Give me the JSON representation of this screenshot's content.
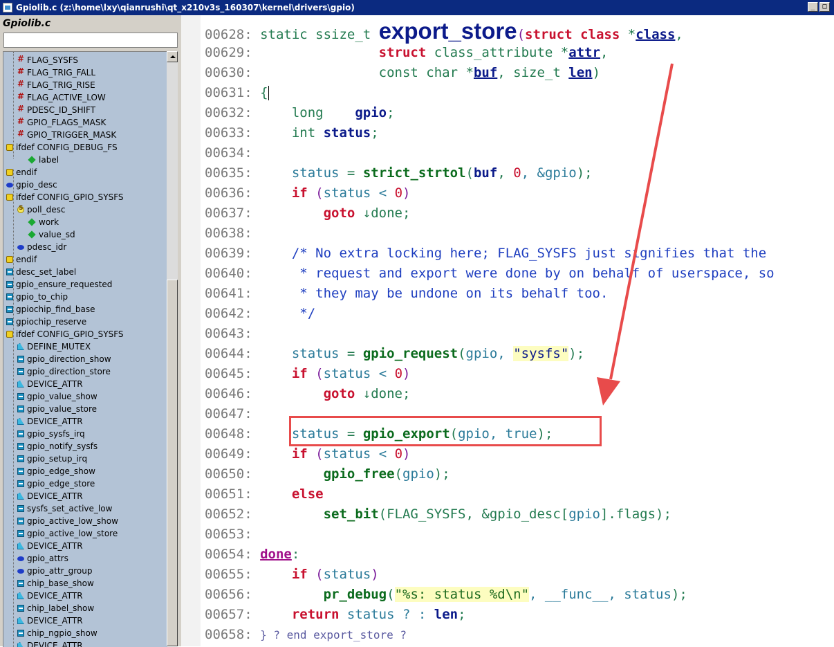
{
  "window": {
    "title": "Gpiolib.c (z:\\home\\lxy\\qianrushi\\qt_x210v3s_160307\\kernel\\drivers\\gpio)",
    "minimize": "_",
    "maximize": "□"
  },
  "sidebar": {
    "title": "Gpiolib.c",
    "search_value": "",
    "items": [
      {
        "label": "FLAG_SYSFS",
        "icon": "define-hash-icon"
      },
      {
        "label": "FLAG_TRIG_FALL",
        "icon": "define-hash-icon"
      },
      {
        "label": "FLAG_TRIG_RISE",
        "icon": "define-hash-icon"
      },
      {
        "label": "FLAG_ACTIVE_LOW",
        "icon": "define-hash-icon"
      },
      {
        "label": "PDESC_ID_SHIFT",
        "icon": "define-hash-icon"
      },
      {
        "label": "GPIO_FLAGS_MASK",
        "icon": "define-hash-icon"
      },
      {
        "label": "GPIO_TRIGGER_MASK",
        "icon": "define-hash-icon"
      },
      {
        "label": "ifdef CONFIG_DEBUG_FS",
        "icon": "ifdef-icon"
      },
      {
        "label": "label",
        "icon": "member-diamond-icon"
      },
      {
        "label": "endif",
        "icon": "ifdef-icon"
      },
      {
        "label": "gpio_desc",
        "icon": "struct-icon"
      },
      {
        "label": "ifdef CONFIG_GPIO_SYSFS",
        "icon": "ifdef-icon"
      },
      {
        "label": "poll_desc",
        "icon": "struct-s-icon"
      },
      {
        "label": "work",
        "icon": "member-diamond-icon"
      },
      {
        "label": "value_sd",
        "icon": "member-diamond-icon"
      },
      {
        "label": "pdesc_idr",
        "icon": "struct-icon"
      },
      {
        "label": "endif",
        "icon": "ifdef-icon"
      },
      {
        "label": "desc_set_label",
        "icon": "function-icon"
      },
      {
        "label": "gpio_ensure_requested",
        "icon": "function-icon"
      },
      {
        "label": "gpio_to_chip",
        "icon": "function-icon"
      },
      {
        "label": "gpiochip_find_base",
        "icon": "function-icon"
      },
      {
        "label": "gpiochip_reserve",
        "icon": "function-icon"
      },
      {
        "label": "ifdef CONFIG_GPIO_SYSFS",
        "icon": "ifdef-icon"
      },
      {
        "label": "DEFINE_MUTEX",
        "icon": "macro-icon"
      },
      {
        "label": "gpio_direction_show",
        "icon": "function-icon"
      },
      {
        "label": "gpio_direction_store",
        "icon": "function-icon"
      },
      {
        "label": "DEVICE_ATTR",
        "icon": "macro-icon"
      },
      {
        "label": "gpio_value_show",
        "icon": "function-icon"
      },
      {
        "label": "gpio_value_store",
        "icon": "function-icon"
      },
      {
        "label": "DEVICE_ATTR",
        "icon": "macro-icon"
      },
      {
        "label": "gpio_sysfs_irq",
        "icon": "function-icon"
      },
      {
        "label": "gpio_notify_sysfs",
        "icon": "function-icon"
      },
      {
        "label": "gpio_setup_irq",
        "icon": "function-icon"
      },
      {
        "label": "gpio_edge_show",
        "icon": "function-icon"
      },
      {
        "label": "gpio_edge_store",
        "icon": "function-icon"
      },
      {
        "label": "DEVICE_ATTR",
        "icon": "macro-icon"
      },
      {
        "label": "sysfs_set_active_low",
        "icon": "function-icon"
      },
      {
        "label": "gpio_active_low_show",
        "icon": "function-icon"
      },
      {
        "label": "gpio_active_low_store",
        "icon": "function-icon"
      },
      {
        "label": "DEVICE_ATTR",
        "icon": "macro-icon"
      },
      {
        "label": "gpio_attrs",
        "icon": "struct-icon"
      },
      {
        "label": "gpio_attr_group",
        "icon": "struct-icon"
      },
      {
        "label": "chip_base_show",
        "icon": "function-icon"
      },
      {
        "label": "DEVICE_ATTR",
        "icon": "macro-icon"
      },
      {
        "label": "chip_label_show",
        "icon": "function-icon"
      },
      {
        "label": "DEVICE_ATTR",
        "icon": "macro-icon"
      },
      {
        "label": "chip_ngpio_show",
        "icon": "function-icon"
      },
      {
        "label": "DEVICE_ATTR",
        "icon": "macro-icon"
      }
    ]
  },
  "editor": {
    "line_numbers": [
      "00628:",
      "00629:",
      "00630:",
      "00631:",
      "00632:",
      "00633:",
      "00634:",
      "00635:",
      "00636:",
      "00637:",
      "00638:",
      "00639:",
      "00640:",
      "00641:",
      "00642:",
      "00643:",
      "00644:",
      "00645:",
      "00646:",
      "00647:",
      "00648:",
      "00649:",
      "00650:",
      "00651:",
      "00652:",
      "00653:",
      "00654:",
      "00655:",
      "00656:",
      "00657:",
      "00658:"
    ],
    "code": {
      "l628_static": "static ssize_t ",
      "l628_fname": "export_store",
      "l628_paren": "(",
      "l628_struct": "struct class",
      "l628_ptr": " *",
      "l628_param": "class",
      "l628_comma": ",",
      "l629_struct": "struct",
      "l629_type": " class_attribute ",
      "l629_ptr": "*",
      "l629_param": "attr",
      "l629_comma": ",",
      "l630_type": "const char ",
      "l630_ptr": "*",
      "l630_param1": "buf",
      "l630_mid": ", size_t ",
      "l630_param2": "len",
      "l630_close": ")",
      "l631_brace": "{",
      "l632_type": "long    ",
      "l632_var": "gpio",
      "l632_semi": ";",
      "l633_type": "int ",
      "l633_var": "status",
      "l633_semi": ";",
      "l635_var": "status",
      "l635_eq": " = ",
      "l635_fn": "strict_strtol",
      "l635_open": "(",
      "l635_arg1": "buf",
      "l635_sep": ", ",
      "l635_num": "0",
      "l635_rest": ", &gpio",
      "l635_close": ");",
      "l636_kw": "if",
      "l636_open": " (",
      "l636_cond": "status < ",
      "l636_num": "0",
      "l636_close": ")",
      "l637_kw": "goto",
      "l637_label": " ↓done",
      "l637_semi": ";",
      "l639": "/* No extra locking here; FLAG_SYSFS just signifies that the",
      "l640": " * request and export were done by on behalf of userspace, so",
      "l641": " * they may be undone on its behalf too.",
      "l642": " */",
      "l644_var": "status",
      "l644_eq": " = ",
      "l644_fn": "gpio_request",
      "l644_open": "(",
      "l644_arg": "gpio, ",
      "l644_str": "\"sysfs\"",
      "l644_close": ");",
      "l645_kw": "if",
      "l645_open": " (",
      "l645_cond": "status < ",
      "l645_num": "0",
      "l645_close": ")",
      "l646_kw": "goto",
      "l646_label": " ↓done",
      "l646_semi": ";",
      "l648_var": "status",
      "l648_eq": " = ",
      "l648_fn": "gpio_export",
      "l648_open": "(",
      "l648_arg": "gpio, true",
      "l648_close": ");",
      "l649_kw": "if",
      "l649_open": " (",
      "l649_cond": "status < ",
      "l649_num": "0",
      "l649_close": ")",
      "l650_fn": "gpio_free",
      "l650_open": "(",
      "l650_arg": "gpio",
      "l650_close": ");",
      "l651_kw": "else",
      "l652_fn": "set_bit",
      "l652_args": "(FLAG_SYSFS, &gpio_desc[",
      "l652_idx": "gpio",
      "l652_tail": "].flags);",
      "l654_label": "done",
      "l654_colon": ":",
      "l655_kw": "if",
      "l655_open": " (",
      "l655_cond": "status",
      "l655_close": ")",
      "l656_fn": "pr_debug",
      "l656_open": "(",
      "l656_str": "\"%s: status %d\\n\"",
      "l656_args": ", __func__, status",
      "l656_close": ");",
      "l657_kw": "return",
      "l657_var": " status ? : ",
      "l657_len": "len",
      "l657_semi": ";",
      "l658": "} ? end export_store ?"
    }
  },
  "colors": {
    "highlight_box": "#e84b4b",
    "arrow": "#e84b4b",
    "tree_bg": "#b3c3d6",
    "titlebar": "#0b2a80"
  }
}
